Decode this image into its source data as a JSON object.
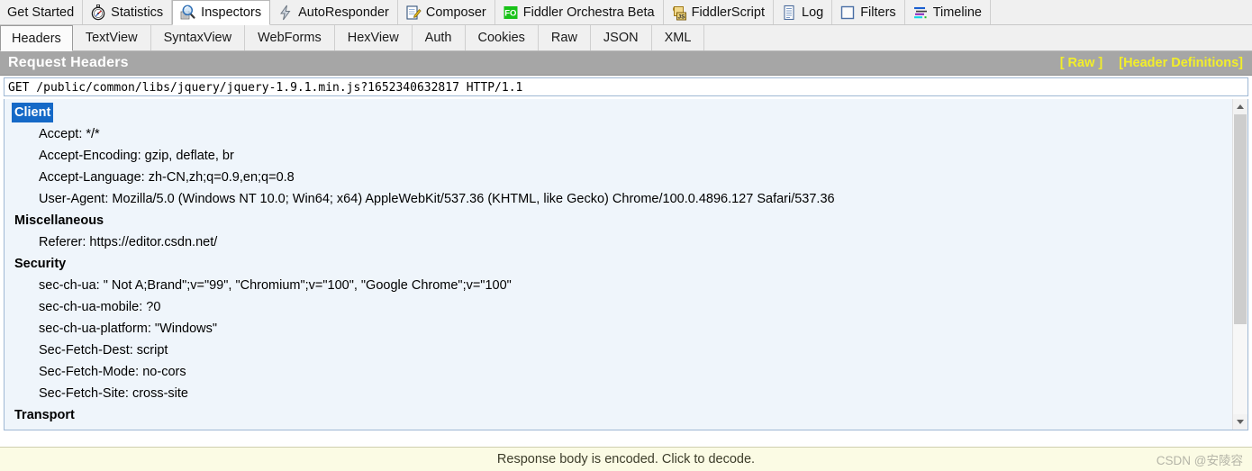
{
  "main_tabs": [
    {
      "label": "Get Started",
      "icon": "",
      "selected": false
    },
    {
      "label": "Statistics",
      "icon": "stopwatch-icon",
      "selected": false
    },
    {
      "label": "Inspectors",
      "icon": "magnifier-icon",
      "selected": true
    },
    {
      "label": "AutoResponder",
      "icon": "lightning-bolt-icon",
      "selected": false
    },
    {
      "label": "Composer",
      "icon": "notepad-pencil-icon",
      "selected": false
    },
    {
      "label": "Fiddler Orchestra Beta",
      "icon": "fo-badge-icon",
      "selected": false
    },
    {
      "label": "FiddlerScript",
      "icon": "js-scroll-icon",
      "selected": false
    },
    {
      "label": "Log",
      "icon": "log-lines-icon",
      "selected": false
    },
    {
      "label": "Filters",
      "icon": "checkbox-icon",
      "selected": false
    },
    {
      "label": "Timeline",
      "icon": "timeline-bars-icon",
      "selected": false
    }
  ],
  "sub_tabs": [
    {
      "label": "Headers",
      "selected": true
    },
    {
      "label": "TextView",
      "selected": false
    },
    {
      "label": "SyntaxView",
      "selected": false
    },
    {
      "label": "WebForms",
      "selected": false
    },
    {
      "label": "HexView",
      "selected": false
    },
    {
      "label": "Auth",
      "selected": false
    },
    {
      "label": "Cookies",
      "selected": false
    },
    {
      "label": "Raw",
      "selected": false
    },
    {
      "label": "JSON",
      "selected": false
    },
    {
      "label": "XML",
      "selected": false
    }
  ],
  "section": {
    "title": "Request Headers",
    "link_raw": "[ Raw ]",
    "link_header_definitions": "[Header Definitions]",
    "link_color": "#f2ee2a",
    "title_bar_color": "#a6a6a6"
  },
  "request_line": "GET /public/common/libs/jquery/jquery-1.9.1.min.js?1652340632817 HTTP/1.1",
  "headers": [
    {
      "type": "group",
      "label": "Client",
      "selected": true
    },
    {
      "type": "item",
      "label": "Accept: */*"
    },
    {
      "type": "item",
      "label": "Accept-Encoding: gzip, deflate, br"
    },
    {
      "type": "item",
      "label": "Accept-Language: zh-CN,zh;q=0.9,en;q=0.8"
    },
    {
      "type": "item",
      "label": "User-Agent: Mozilla/5.0 (Windows NT 10.0; Win64; x64) AppleWebKit/537.36 (KHTML, like Gecko) Chrome/100.0.4896.127 Safari/537.36"
    },
    {
      "type": "group",
      "label": "Miscellaneous",
      "selected": false
    },
    {
      "type": "item",
      "label": "Referer: https://editor.csdn.net/"
    },
    {
      "type": "group",
      "label": "Security",
      "selected": false
    },
    {
      "type": "item",
      "label": "sec-ch-ua: \" Not A;Brand\";v=\"99\", \"Chromium\";v=\"100\", \"Google Chrome\";v=\"100\""
    },
    {
      "type": "item",
      "label": "sec-ch-ua-mobile: ?0"
    },
    {
      "type": "item",
      "label": "sec-ch-ua-platform: \"Windows\""
    },
    {
      "type": "item",
      "label": "Sec-Fetch-Dest: script"
    },
    {
      "type": "item",
      "label": "Sec-Fetch-Mode: no-cors"
    },
    {
      "type": "item",
      "label": "Sec-Fetch-Site: cross-site"
    },
    {
      "type": "group",
      "label": "Transport",
      "selected": false
    }
  ],
  "scrollbar": {
    "thumb_percent": 70
  },
  "status": {
    "message": "Response body is encoded. Click to decode.",
    "watermark": "CSDN @安陵容"
  }
}
